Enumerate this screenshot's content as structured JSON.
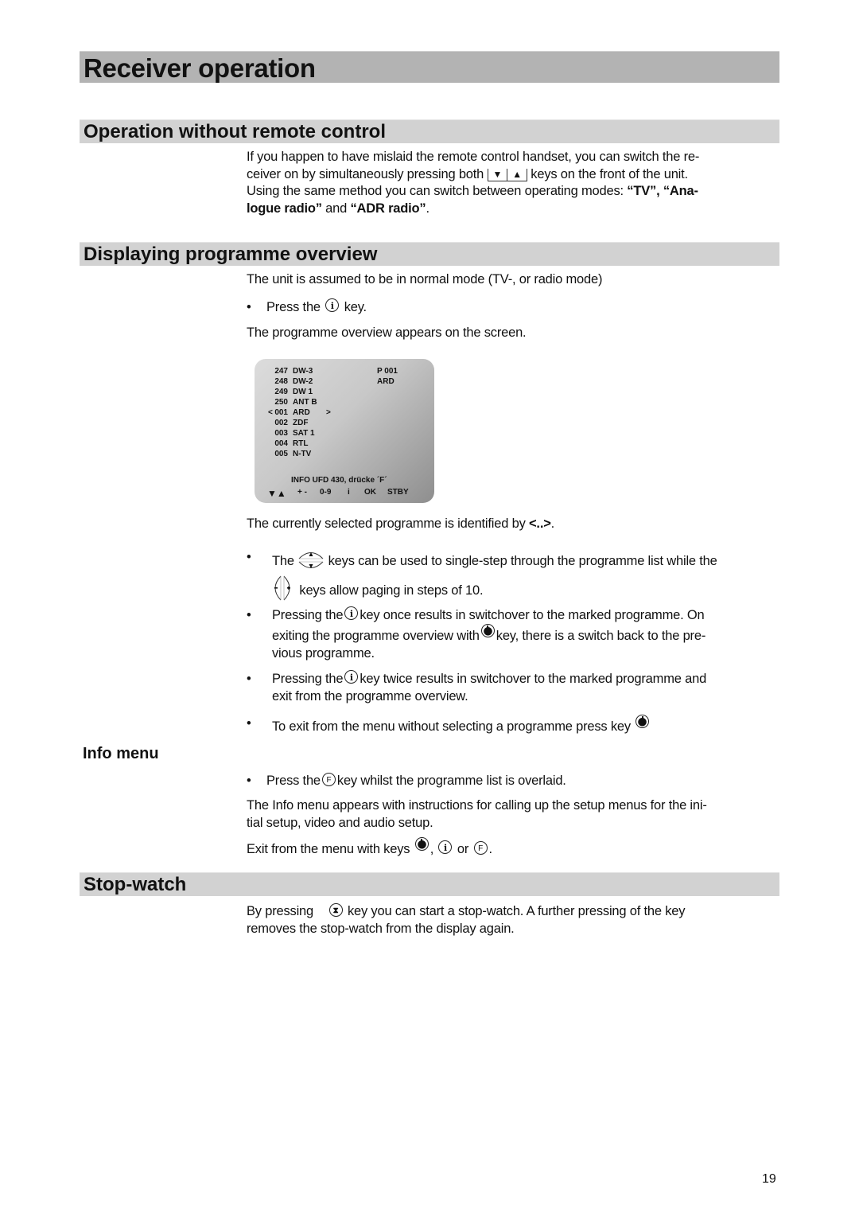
{
  "page": {
    "title": "Receiver operation",
    "page_number": "19"
  },
  "section1": {
    "heading": "Operation without remote control",
    "para_part1": "If you happen to have mislaid the remote control handset, you can switch the re-ceiver on by simultaneously pressing both",
    "line1": "If you happen to have mislaid the remote control handset, you can switch the re-",
    "line2a": "ceiver on by simultaneously pressing both",
    "key_down": "▼",
    "key_up": "▲",
    "line2b": "keys on the front of the unit.",
    "line3a": "Using the same method you can switch between operating modes: ",
    "mode_tv": "“TV”, “Ana-",
    "mode_analogue": "logue radio”",
    "and": " and ",
    "mode_adr": "“ADR radio”",
    "period": "."
  },
  "section2": {
    "heading": "Displaying programme overview",
    "intro": "The unit is assumed to be in normal mode (TV-, or radio mode)",
    "bullet": "•",
    "press_the": "Press the",
    "key_word": "key.",
    "appears": "The programme overview appears on the screen.",
    "screen": {
      "rows": [
        {
          "num": "247",
          "name": "DW-3"
        },
        {
          "num": "248",
          "name": "DW-2"
        },
        {
          "num": "249",
          "name": "DW 1"
        },
        {
          "num": "250",
          "name": "ANT B"
        },
        {
          "num": "001",
          "name": "ARD",
          "selected": true
        },
        {
          "num": "002",
          "name": "ZDF"
        },
        {
          "num": "003",
          "name": "SAT 1"
        },
        {
          "num": "004",
          "name": "RTL"
        },
        {
          "num": "005",
          "name": "N-TV"
        }
      ],
      "sel_left": "<",
      "sel_right": ">",
      "current_pnum": "P 001",
      "current_name": "ARD",
      "info_line": "INFO  UFD 430,  drücke  ´F´",
      "footer": [
        "▼▲",
        "+ -",
        "0-9",
        "i",
        "OK",
        "STBY"
      ]
    },
    "selected_text": "The currently selected programme is identified by ",
    "selected_marker": "<..>",
    "b1_a": "The",
    "b1_b": "keys can be used to single-step through the programme list while the",
    "b1_c": "keys allow paging in steps of 10.",
    "b2_a": "Pressing the",
    "b2_b": "key once results in switchover to the marked programme. On",
    "b2_c": "exiting the programme overview with",
    "b2_d": "key, there is a switch back to the pre-",
    "b2_e": "vious programme.",
    "b3_a": "Pressing the",
    "b3_b": "key twice results in switchover to the marked programme and",
    "b3_c": "exit from the programme overview.",
    "b4_a": "To exit from the menu without selecting a programme press key"
  },
  "info_menu": {
    "heading": "Info menu",
    "b_a": "Press the",
    "b_b": "key whilst the programme list is overlaid.",
    "para1": "The Info menu appears with instructions for calling up the setup menus for the ini-",
    "para1b": "tial setup, video and audio setup.",
    "exit_a": "Exit from the menu with keys",
    "exit_comma": ",",
    "exit_or": "or",
    "exit_end": "."
  },
  "section3": {
    "heading": "Stop-watch",
    "line1a": "By pressing",
    "line1b": "key you can start a stop-watch. A further pressing of the key",
    "line2": "removes the stop-watch from the display again."
  },
  "icons": {
    "info": "i",
    "function": "F",
    "stopwatch": "⧗"
  }
}
